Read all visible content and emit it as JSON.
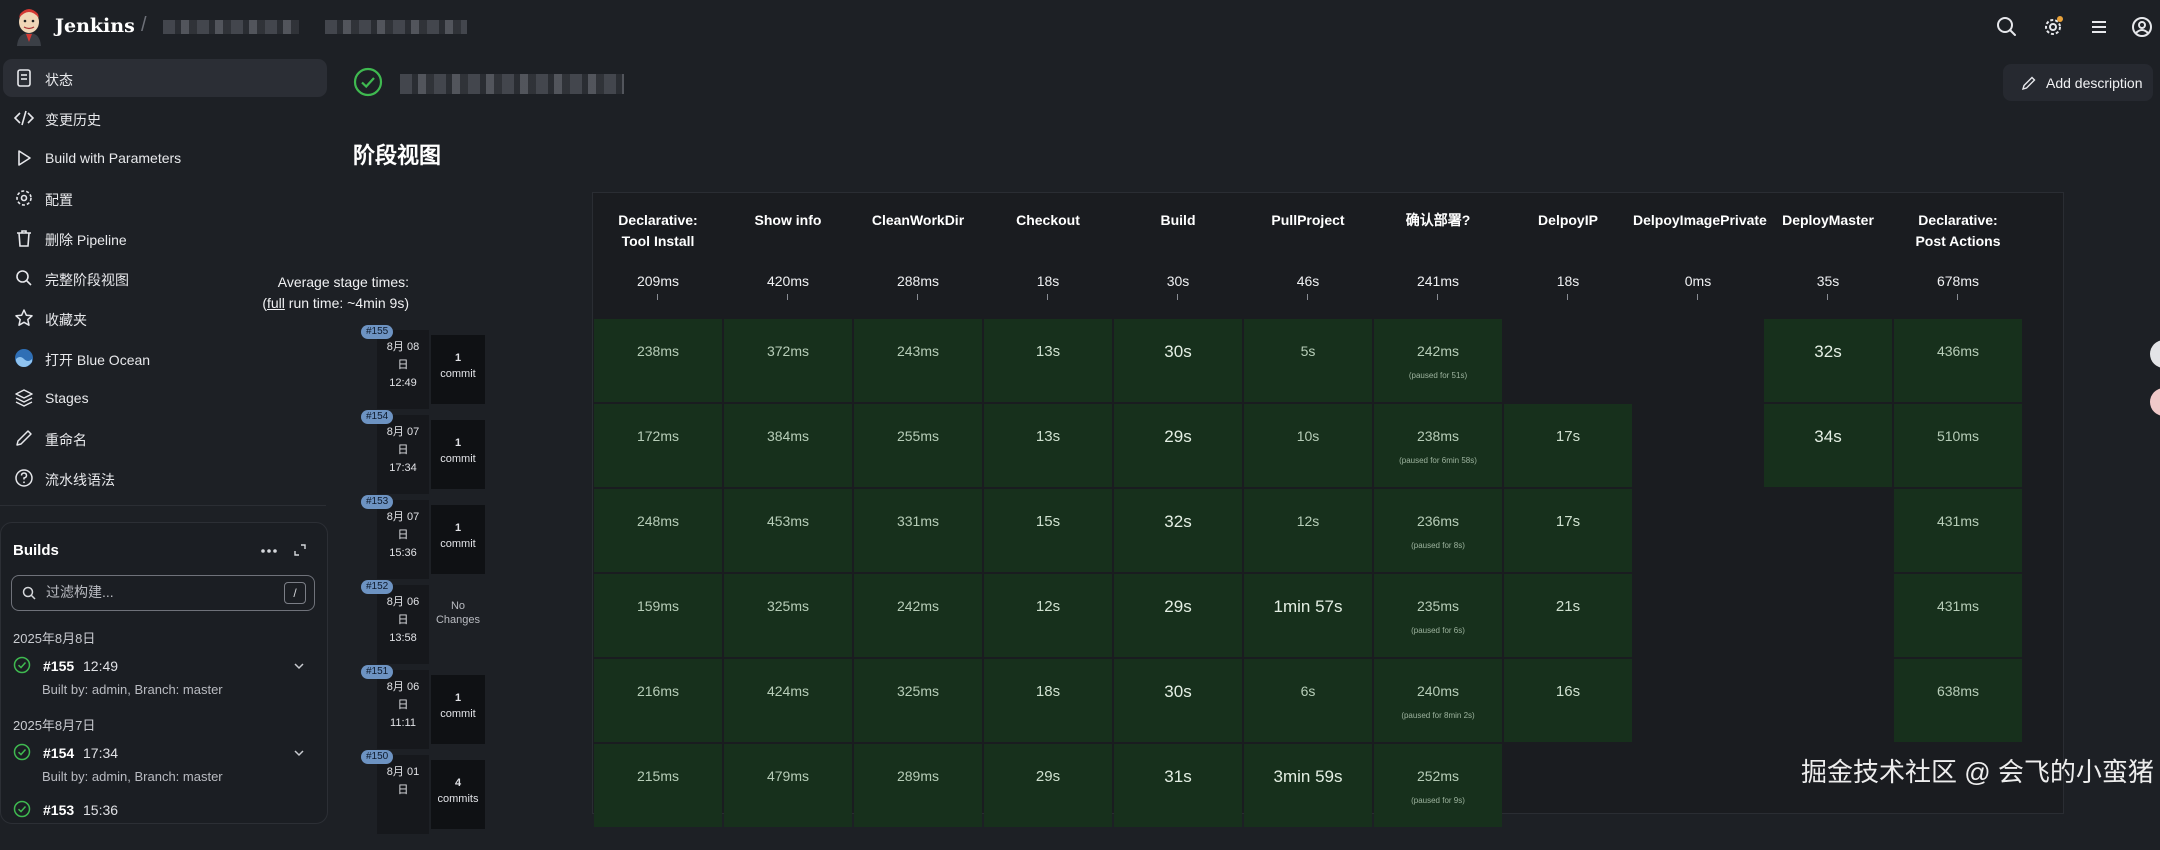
{
  "header": {
    "app_name": "Jenkins",
    "breadcrumb_separator": "/",
    "icons": [
      "search-icon",
      "gear-icon",
      "menu-icon",
      "user-icon"
    ],
    "notification_dot_color": "#e9a23b"
  },
  "sidebar": {
    "items": [
      {
        "label": "状态",
        "icon": "document-icon",
        "active": true
      },
      {
        "label": "变更历史",
        "icon": "code-icon"
      },
      {
        "label": "Build with Parameters",
        "icon": "play-icon"
      },
      {
        "label": "配置",
        "icon": "gear-icon"
      },
      {
        "label": "删除 Pipeline",
        "icon": "trash-icon"
      },
      {
        "label": "完整阶段视图",
        "icon": "search-icon"
      },
      {
        "label": "收藏夹",
        "icon": "star-icon"
      },
      {
        "label": "打开 Blue Ocean",
        "icon": "blue-ocean-icon"
      },
      {
        "label": "Stages",
        "icon": "layers-icon"
      },
      {
        "label": "重命名",
        "icon": "pencil-icon"
      },
      {
        "label": "流水线语法",
        "icon": "help-icon"
      }
    ]
  },
  "builds": {
    "title": "Builds",
    "search_placeholder": "过滤构建...",
    "search_shortcut": "/",
    "groups": [
      {
        "date": "2025年8月8日",
        "items": [
          {
            "number": "#155",
            "time": "12:49",
            "meta": "Built by: admin, Branch: master"
          }
        ]
      },
      {
        "date": "2025年8月7日",
        "items": [
          {
            "number": "#154",
            "time": "17:34",
            "meta": "Built by: admin, Branch: master"
          },
          {
            "number": "#153",
            "time": "15:36",
            "meta": ""
          }
        ]
      }
    ]
  },
  "main": {
    "add_description": "Add description",
    "status_color": "#3fb950",
    "stage_view_title": "阶段视图",
    "average_label_1": "Average stage times:",
    "average_label_2_link": "full",
    "average_label_2_rest": " run time: ~4min 9s)",
    "average_label_2_open": "(",
    "stages": [
      {
        "name": "Declarative:\nTool Install",
        "avg": "209ms"
      },
      {
        "name": "Show info",
        "avg": "420ms"
      },
      {
        "name": "CleanWorkDir",
        "avg": "288ms"
      },
      {
        "name": "Checkout",
        "avg": "18s"
      },
      {
        "name": "Build",
        "avg": "30s"
      },
      {
        "name": "PullProject",
        "avg": "46s"
      },
      {
        "name": "确认部署?",
        "avg": "241ms"
      },
      {
        "name": "DelpoyIP",
        "avg": "18s"
      },
      {
        "name": "DelpoyImagePrivate",
        "avg": "0ms"
      },
      {
        "name": "DeployMaster",
        "avg": "35s"
      },
      {
        "name": "Declarative:\nPost Actions",
        "avg": "678ms"
      }
    ],
    "runs": [
      {
        "badge": "#155",
        "date": "8月 08",
        "day": "日",
        "time": "12:49",
        "changes_count": "1",
        "changes_label": "commit",
        "cells": [
          "238ms",
          "372ms",
          "243ms",
          "13s",
          "30s",
          "5s",
          "242ms",
          "",
          "",
          "32s",
          "436ms"
        ],
        "paused": "(paused for 51s)"
      },
      {
        "badge": "#154",
        "date": "8月 07",
        "day": "日",
        "time": "17:34",
        "changes_count": "1",
        "changes_label": "commit",
        "cells": [
          "172ms",
          "384ms",
          "255ms",
          "13s",
          "29s",
          "10s",
          "238ms",
          "17s",
          "",
          "34s",
          "510ms"
        ],
        "paused": "(paused for 6min 58s)"
      },
      {
        "badge": "#153",
        "date": "8月 07",
        "day": "日",
        "time": "15:36",
        "changes_count": "1",
        "changes_label": "commit",
        "cells": [
          "248ms",
          "453ms",
          "331ms",
          "15s",
          "32s",
          "12s",
          "236ms",
          "17s",
          "",
          "",
          "431ms"
        ],
        "paused": "(paused for 8s)"
      },
      {
        "badge": "#152",
        "date": "8月 06",
        "day": "日",
        "time": "13:58",
        "changes_count": "No",
        "changes_label": "Changes",
        "cells": [
          "159ms",
          "325ms",
          "242ms",
          "12s",
          "29s",
          "1min 57s",
          "235ms",
          "21s",
          "",
          "",
          "431ms"
        ],
        "paused": "(paused for 6s)"
      },
      {
        "badge": "#151",
        "date": "8月 06",
        "day": "日",
        "time": "11:11",
        "changes_count": "1",
        "changes_label": "commit",
        "cells": [
          "216ms",
          "424ms",
          "325ms",
          "18s",
          "30s",
          "6s",
          "240ms",
          "16s",
          "",
          "",
          "638ms"
        ],
        "paused": "(paused for 8min 2s)"
      },
      {
        "badge": "#150",
        "date": "8月 01",
        "day": "日",
        "time": "",
        "changes_count": "4",
        "changes_label": "commits",
        "cells": [
          "215ms",
          "479ms",
          "289ms",
          "29s",
          "31s",
          "3min 59s",
          "252ms",
          "",
          "",
          "",
          ""
        ],
        "paused": "(paused for 9s)"
      }
    ]
  },
  "watermark": "掘金技术社区 @ 会飞的小蛮猪"
}
